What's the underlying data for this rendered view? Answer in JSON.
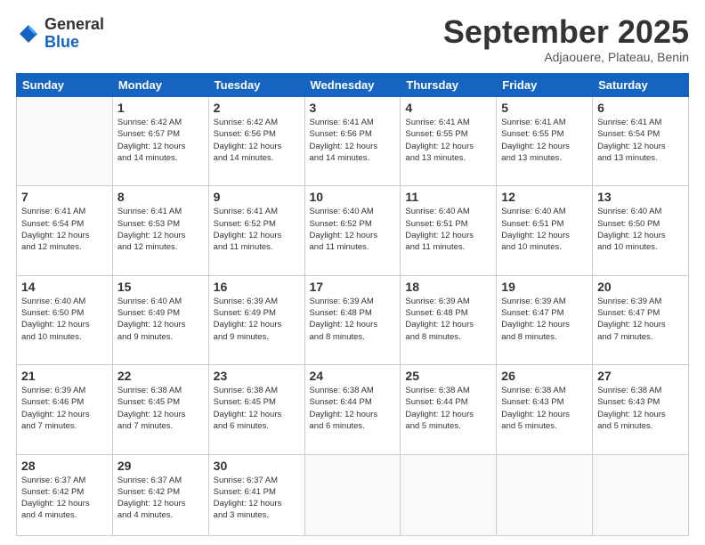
{
  "logo": {
    "general": "General",
    "blue": "Blue"
  },
  "header": {
    "month": "September 2025",
    "location": "Adjaouere, Plateau, Benin"
  },
  "weekdays": [
    "Sunday",
    "Monday",
    "Tuesday",
    "Wednesday",
    "Thursday",
    "Friday",
    "Saturday"
  ],
  "weeks": [
    [
      {
        "num": "",
        "info": ""
      },
      {
        "num": "1",
        "info": "Sunrise: 6:42 AM\nSunset: 6:57 PM\nDaylight: 12 hours\nand 14 minutes."
      },
      {
        "num": "2",
        "info": "Sunrise: 6:42 AM\nSunset: 6:56 PM\nDaylight: 12 hours\nand 14 minutes."
      },
      {
        "num": "3",
        "info": "Sunrise: 6:41 AM\nSunset: 6:56 PM\nDaylight: 12 hours\nand 14 minutes."
      },
      {
        "num": "4",
        "info": "Sunrise: 6:41 AM\nSunset: 6:55 PM\nDaylight: 12 hours\nand 13 minutes."
      },
      {
        "num": "5",
        "info": "Sunrise: 6:41 AM\nSunset: 6:55 PM\nDaylight: 12 hours\nand 13 minutes."
      },
      {
        "num": "6",
        "info": "Sunrise: 6:41 AM\nSunset: 6:54 PM\nDaylight: 12 hours\nand 13 minutes."
      }
    ],
    [
      {
        "num": "7",
        "info": "Sunrise: 6:41 AM\nSunset: 6:54 PM\nDaylight: 12 hours\nand 12 minutes."
      },
      {
        "num": "8",
        "info": "Sunrise: 6:41 AM\nSunset: 6:53 PM\nDaylight: 12 hours\nand 12 minutes."
      },
      {
        "num": "9",
        "info": "Sunrise: 6:41 AM\nSunset: 6:52 PM\nDaylight: 12 hours\nand 11 minutes."
      },
      {
        "num": "10",
        "info": "Sunrise: 6:40 AM\nSunset: 6:52 PM\nDaylight: 12 hours\nand 11 minutes."
      },
      {
        "num": "11",
        "info": "Sunrise: 6:40 AM\nSunset: 6:51 PM\nDaylight: 12 hours\nand 11 minutes."
      },
      {
        "num": "12",
        "info": "Sunrise: 6:40 AM\nSunset: 6:51 PM\nDaylight: 12 hours\nand 10 minutes."
      },
      {
        "num": "13",
        "info": "Sunrise: 6:40 AM\nSunset: 6:50 PM\nDaylight: 12 hours\nand 10 minutes."
      }
    ],
    [
      {
        "num": "14",
        "info": "Sunrise: 6:40 AM\nSunset: 6:50 PM\nDaylight: 12 hours\nand 10 minutes."
      },
      {
        "num": "15",
        "info": "Sunrise: 6:40 AM\nSunset: 6:49 PM\nDaylight: 12 hours\nand 9 minutes."
      },
      {
        "num": "16",
        "info": "Sunrise: 6:39 AM\nSunset: 6:49 PM\nDaylight: 12 hours\nand 9 minutes."
      },
      {
        "num": "17",
        "info": "Sunrise: 6:39 AM\nSunset: 6:48 PM\nDaylight: 12 hours\nand 8 minutes."
      },
      {
        "num": "18",
        "info": "Sunrise: 6:39 AM\nSunset: 6:48 PM\nDaylight: 12 hours\nand 8 minutes."
      },
      {
        "num": "19",
        "info": "Sunrise: 6:39 AM\nSunset: 6:47 PM\nDaylight: 12 hours\nand 8 minutes."
      },
      {
        "num": "20",
        "info": "Sunrise: 6:39 AM\nSunset: 6:47 PM\nDaylight: 12 hours\nand 7 minutes."
      }
    ],
    [
      {
        "num": "21",
        "info": "Sunrise: 6:39 AM\nSunset: 6:46 PM\nDaylight: 12 hours\nand 7 minutes."
      },
      {
        "num": "22",
        "info": "Sunrise: 6:38 AM\nSunset: 6:45 PM\nDaylight: 12 hours\nand 7 minutes."
      },
      {
        "num": "23",
        "info": "Sunrise: 6:38 AM\nSunset: 6:45 PM\nDaylight: 12 hours\nand 6 minutes."
      },
      {
        "num": "24",
        "info": "Sunrise: 6:38 AM\nSunset: 6:44 PM\nDaylight: 12 hours\nand 6 minutes."
      },
      {
        "num": "25",
        "info": "Sunrise: 6:38 AM\nSunset: 6:44 PM\nDaylight: 12 hours\nand 5 minutes."
      },
      {
        "num": "26",
        "info": "Sunrise: 6:38 AM\nSunset: 6:43 PM\nDaylight: 12 hours\nand 5 minutes."
      },
      {
        "num": "27",
        "info": "Sunrise: 6:38 AM\nSunset: 6:43 PM\nDaylight: 12 hours\nand 5 minutes."
      }
    ],
    [
      {
        "num": "28",
        "info": "Sunrise: 6:37 AM\nSunset: 6:42 PM\nDaylight: 12 hours\nand 4 minutes."
      },
      {
        "num": "29",
        "info": "Sunrise: 6:37 AM\nSunset: 6:42 PM\nDaylight: 12 hours\nand 4 minutes."
      },
      {
        "num": "30",
        "info": "Sunrise: 6:37 AM\nSunset: 6:41 PM\nDaylight: 12 hours\nand 3 minutes."
      },
      {
        "num": "",
        "info": ""
      },
      {
        "num": "",
        "info": ""
      },
      {
        "num": "",
        "info": ""
      },
      {
        "num": "",
        "info": ""
      }
    ]
  ]
}
